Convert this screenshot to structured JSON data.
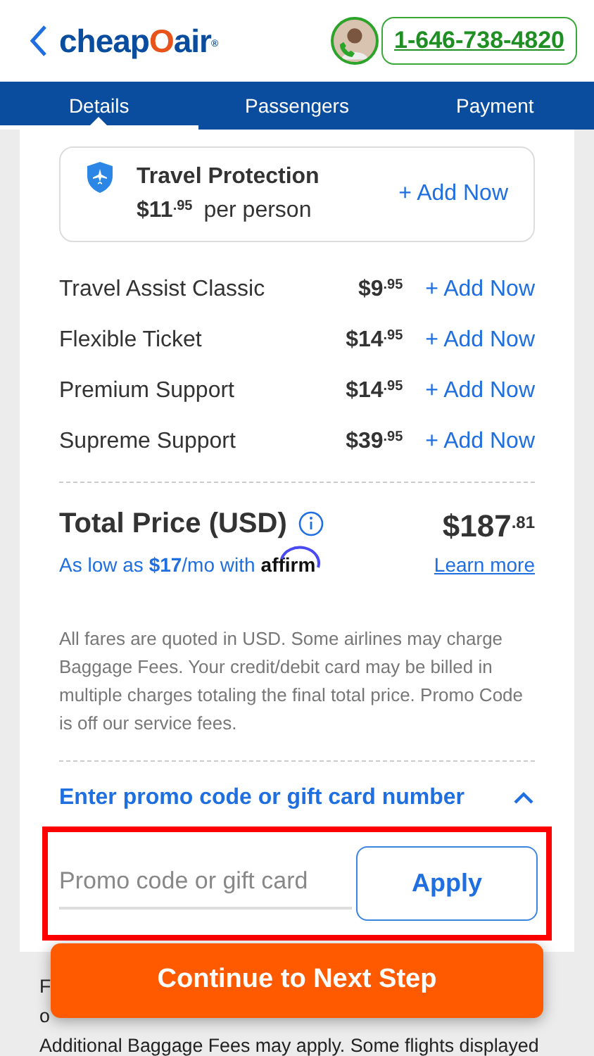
{
  "header": {
    "logo": {
      "prefix": "cheap",
      "mark": "O",
      "suffix": "air",
      "reg": "®"
    },
    "phone": "1-646-738-4820"
  },
  "tabs": [
    {
      "label": "Details",
      "selected": true
    },
    {
      "label": "Passengers",
      "selected": false
    },
    {
      "label": "Payment",
      "selected": false
    }
  ],
  "protection": {
    "title": "Travel Protection",
    "price": "$11",
    "cents": ".95",
    "unit": "per person",
    "action": "+ Add Now"
  },
  "addons": [
    {
      "name": "Travel Assist Classic",
      "price": "$9",
      "cents": ".95",
      "action": "+ Add Now"
    },
    {
      "name": "Flexible Ticket",
      "price": "$14",
      "cents": ".95",
      "action": "+ Add Now"
    },
    {
      "name": "Premium Support",
      "price": "$14",
      "cents": ".95",
      "action": "+ Add Now"
    },
    {
      "name": "Supreme Support",
      "price": "$39",
      "cents": ".95",
      "action": "+ Add Now"
    }
  ],
  "total": {
    "label": "Total Price (USD)",
    "price": "$187",
    "cents": ".81",
    "financing": "As low as **$17**/mo with",
    "affirm": "affirm",
    "learn_more": "Learn more"
  },
  "disclaimer": {
    "before": "All fares are quoted in USD. Some airlines may charge ",
    "link": "Baggage Fees",
    "after": ". Your credit/debit card may be billed in multiple charges totaling the final total price. Promo Code is off our service fees."
  },
  "promo": {
    "title": "Enter promo code or gift card number",
    "expanded": true,
    "placeholder": "Promo code or gift card",
    "apply": "Apply"
  },
  "continue": "Continue to Next Step",
  "footer": {
    "fragment": "F",
    "fragment_link": "o",
    "before": "Additional ",
    "link": "Baggage Fees",
    "after": " may apply. Some flights displayed"
  }
}
